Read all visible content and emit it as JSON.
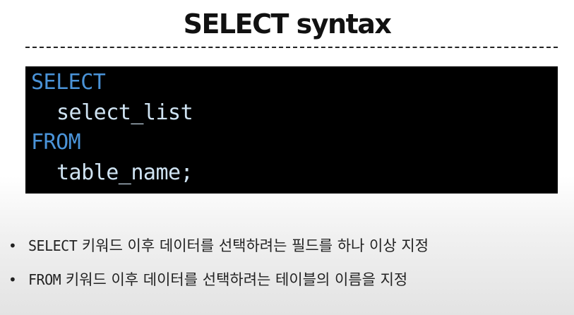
{
  "slide": {
    "title": "SELECT syntax"
  },
  "code": {
    "lines": [
      {
        "text": "SELECT",
        "kind": "keyword"
      },
      {
        "text": "select_list",
        "kind": "identifier"
      },
      {
        "text": "FROM",
        "kind": "keyword"
      },
      {
        "text": "table_name;",
        "kind": "identifier"
      }
    ]
  },
  "bullets": [
    {
      "keyword": "SELECT",
      "text": " 키워드 이후 데이터를 선택하려는 필드를 하나 이상 지정"
    },
    {
      "keyword": "FROM",
      "text": " 키워드 이후 데이터를 선택하려는 테이블의 이름을 지정"
    }
  ],
  "colors": {
    "code_background": "#000000",
    "keyword": "#4a93d8",
    "identifier": "#cfe3f2",
    "title": "#111111"
  }
}
